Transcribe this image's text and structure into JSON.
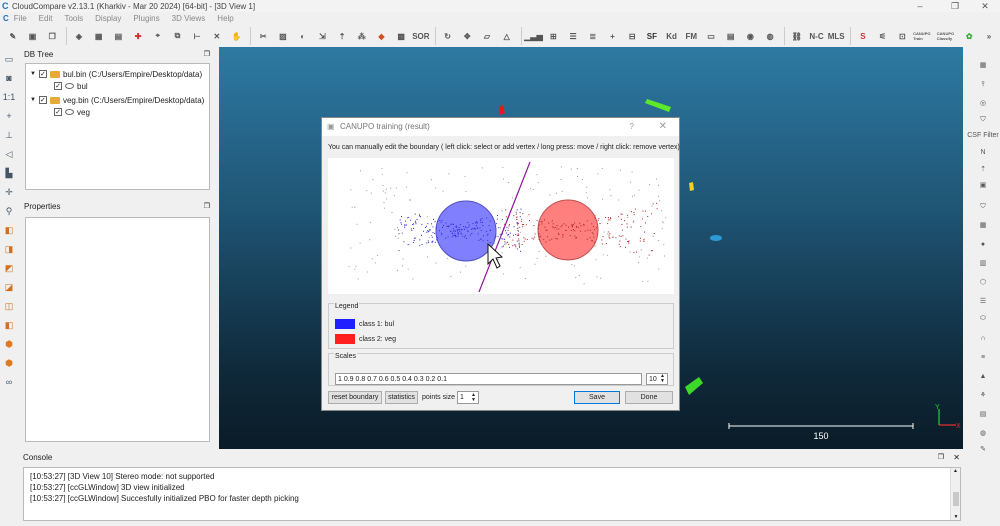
{
  "window": {
    "title": "CloudCompare v2.13.1 (Kharkiv - Mar 20 2024) [64-bit] - [3D View 1]",
    "controls": [
      "–",
      "❐",
      "✕"
    ]
  },
  "menu": [
    "File",
    "Edit",
    "Tools",
    "Display",
    "Plugins",
    "3D Views",
    "Help"
  ],
  "toolbar": {
    "labels": [
      "SOR",
      "SF",
      "Kd",
      "FM",
      "N-C",
      "MLS",
      "CANUPO Train",
      "CANUPO Classify"
    ]
  },
  "db_tree": {
    "title": "DB Tree",
    "items": [
      {
        "label": "bul.bin (C:/Users/Empire/Desktop/data)",
        "child": "bul"
      },
      {
        "label": "veg.bin (C:/Users/Empire/Desktop/data)",
        "child": "veg"
      }
    ]
  },
  "properties": {
    "title": "Properties"
  },
  "dialog": {
    "title": "CANUPO training (result)",
    "help": "?",
    "close": "✕",
    "instructions": "You can manually edit the boundary ( left click: select or add vertex / long press: move / right click: remove vertex)",
    "legend_title": "Legend",
    "legend": [
      {
        "label": "class 1: bul",
        "color": "#1f1fff"
      },
      {
        "label": "class 2: veg",
        "color": "#ff1f1f"
      }
    ],
    "scales_title": "Scales",
    "scales_value": "1 0.9 0.8 0.7 0.6 0.5 0.4 0.3 0.2 0.1",
    "scales_count": "10",
    "reset_label": "reset boundary",
    "statistics_label": "statistics",
    "points_size_label": "points size",
    "points_size_value": "1",
    "save_label": "Save",
    "done_label": "Done"
  },
  "view": {
    "scale_label": "150",
    "axis_y": "Y",
    "axis_x": "X"
  },
  "right_tools": {
    "csf_label": "CSF Filter"
  },
  "console": {
    "title": "Console",
    "lines": [
      "[10:53:27] [3D View 10] Stereo mode: not supported",
      "[10:53:27] [ccGLWindow] 3D view initialized",
      "[10:53:27] [ccGLWindow] Succesfully initialized PBO for faster depth picking"
    ]
  }
}
